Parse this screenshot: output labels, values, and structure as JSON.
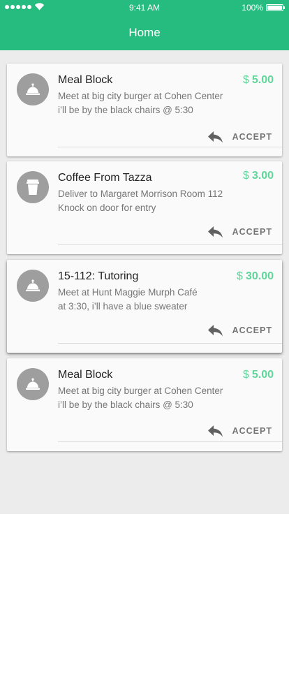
{
  "status_bar": {
    "time": "9:41 AM",
    "battery": "100%"
  },
  "header": {
    "title": "Home"
  },
  "colors": {
    "header": "#26bc7f",
    "price": "#5fd69a",
    "background": "#ececec",
    "avatar": "#9e9e9e"
  },
  "requests": [
    {
      "icon": "service-bell-icon",
      "title": "Meal Block",
      "line1": "Meet at big city burger at Cohen Center",
      "line2": "i’ll be by the black chairs @ 5:30",
      "currency": "$",
      "amount": "5.00",
      "action": "ACCEPT"
    },
    {
      "icon": "coffee-cup-icon",
      "title": "Coffee From Tazza",
      "line1": "Deliver to Margaret Morrison Room 112",
      "line2": "Knock on door for entry",
      "currency": "$",
      "amount": "3.00",
      "action": "ACCEPT"
    },
    {
      "icon": "service-bell-icon",
      "title": "15-112: Tutoring",
      "line1": "Meet at Hunt Maggie Murph Café",
      "line2": "at 3:30, i’ll have a blue sweater",
      "currency": "$",
      "amount": "30.00",
      "action": "ACCEPT"
    },
    {
      "icon": "service-bell-icon",
      "title": "Meal Block",
      "line1": "Meet at big city burger at Cohen Center",
      "line2": "i’ll be by the black chairs @ 5:30",
      "currency": "$",
      "amount": "5.00",
      "action": "ACCEPT"
    }
  ]
}
